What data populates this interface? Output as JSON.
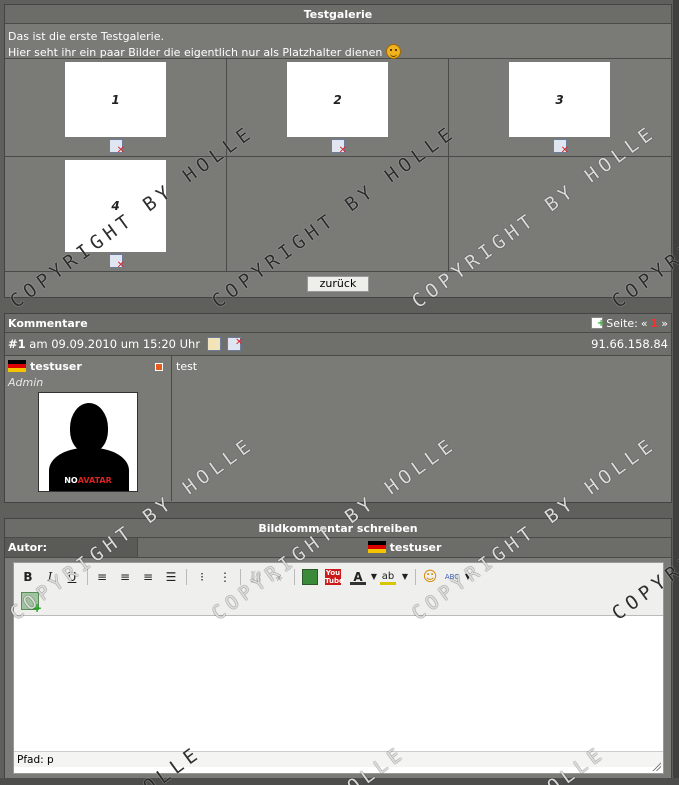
{
  "gallery": {
    "title": "Testgalerie",
    "intro_line1": "Das ist die erste Testgalerie.",
    "intro_line2": "Hier seht ihr ein paar Bilder die eigentlich nur als Platzhalter dienen",
    "images": [
      {
        "label": "1"
      },
      {
        "label": "2"
      },
      {
        "label": "3"
      },
      {
        "label": "4"
      }
    ],
    "back_button": "zurück"
  },
  "comments": {
    "title": "Kommentare",
    "page_label": "Seite:",
    "page_prev": "«",
    "page_current": "1",
    "page_next": "»",
    "entry": {
      "number": "#1",
      "date_text": "am 09.09.2010 um 15:20 Uhr",
      "ip": "91.66.158.84",
      "username": "testuser",
      "role": "Admin",
      "avatar_text_a": "NO",
      "avatar_text_b": "AVATAR",
      "text": "test"
    }
  },
  "write": {
    "title": "Bildkommentar schreiben",
    "author_label": "Autor:",
    "author_name": "testuser",
    "path_label": "Pfad: p"
  },
  "toolbar": {
    "bold": "B",
    "italic": "I",
    "underline": "U",
    "youtube": "You Tube",
    "font_color": "A",
    "highlight": "ab",
    "spell": "ABC"
  },
  "watermark": "COPYRIGHT BY HOLLE",
  "watermark_fragment": "HOLLE"
}
